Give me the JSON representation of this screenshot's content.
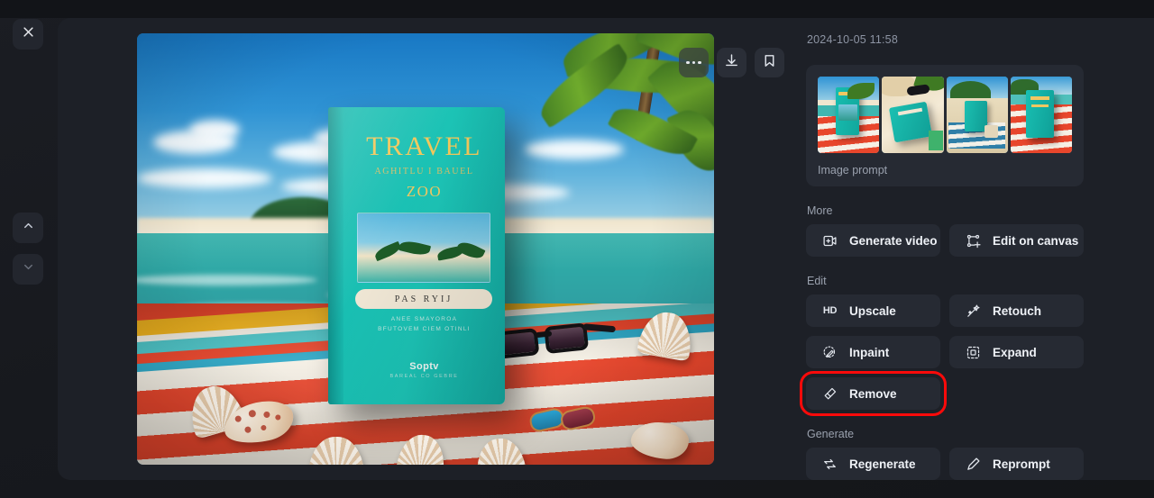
{
  "window": {
    "close_label": "Close",
    "nav_up_label": "Previous image",
    "nav_down_label": "Next image"
  },
  "image_toolbar": {
    "more_label": "More options",
    "download_label": "Download",
    "bookmark_label": "Bookmark"
  },
  "preview": {
    "alt": "Generated image: teal travel book on a striped beach towel with seashells and sunglasses",
    "book": {
      "title": "TRAVEL",
      "subtitle": "AGHITLU I BAUEL",
      "year": "ZOO",
      "band": "PAS  RYIJ",
      "line1": "ANEE SMAYOROA",
      "line2": "BFUTOVEM CIEM OTINLI",
      "brand": "Soptv",
      "brand_sub": "BAREAL CO GEBRE"
    }
  },
  "details": {
    "timestamp": "2024-10-05 11:58",
    "prompt_card": {
      "label": "Image prompt",
      "thumbnails": [
        {
          "name": "thumbnail-1"
        },
        {
          "name": "thumbnail-2"
        },
        {
          "name": "thumbnail-3"
        },
        {
          "name": "thumbnail-4"
        }
      ]
    },
    "sections": [
      {
        "label": "More",
        "buttons": [
          {
            "label": "Generate video",
            "icon": "generate-video-icon"
          },
          {
            "label": "Edit on canvas",
            "icon": "edit-on-canvas-icon"
          }
        ]
      },
      {
        "label": "Edit",
        "buttons": [
          {
            "label": "Upscale",
            "icon": "hd-icon"
          },
          {
            "label": "Retouch",
            "icon": "magic-wand-icon"
          },
          {
            "label": "Inpaint",
            "icon": "inpaint-brush-icon"
          },
          {
            "label": "Expand",
            "icon": "expand-icon"
          },
          {
            "label": "Remove",
            "icon": "eraser-icon",
            "highlighted": true
          }
        ]
      },
      {
        "label": "Generate",
        "buttons": [
          {
            "label": "Regenerate",
            "icon": "regenerate-icon"
          },
          {
            "label": "Reprompt",
            "icon": "pencil-icon"
          }
        ]
      }
    ]
  },
  "colors": {
    "app_background": "#16181d",
    "panel_background": "#1d2027",
    "button_background": "#262a33",
    "text_primary": "#eef1f6",
    "text_muted": "#9aa1ae",
    "highlight": "#fb0a0a",
    "book_teal": "#18bdb1",
    "towel_red": "#e8462c"
  }
}
